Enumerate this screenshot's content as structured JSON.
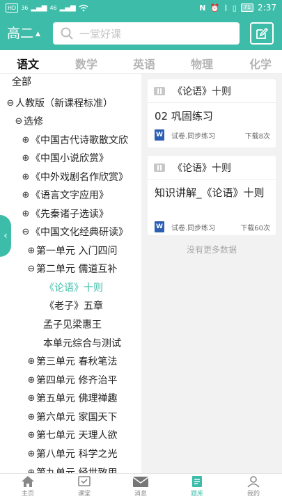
{
  "status_bar": {
    "left_indicators": [
      "HD",
      "36",
      "46"
    ],
    "battery": "71",
    "time": "2:37"
  },
  "header": {
    "grade": "高二",
    "search_placeholder": "一堂好课"
  },
  "tabs": [
    {
      "label": "语文",
      "active": true
    },
    {
      "label": "数学",
      "active": false
    },
    {
      "label": "英语",
      "active": false
    },
    {
      "label": "物理",
      "active": false
    },
    {
      "label": "化学",
      "active": false
    }
  ],
  "tree": [
    {
      "toggle": "",
      "label": "全部"
    },
    {
      "toggle": "⊖",
      "label": "人教版（新课程标准）"
    },
    {
      "toggle": "⊖",
      "label": "选修"
    },
    {
      "toggle": "⊕",
      "label": "《中国古代诗歌散文欣"
    },
    {
      "toggle": "⊕",
      "label": "《中国小说欣赏》"
    },
    {
      "toggle": "⊕",
      "label": "《中外戏剧名作欣赏》"
    },
    {
      "toggle": "⊕",
      "label": "《语言文字应用》"
    },
    {
      "toggle": "⊕",
      "label": "《先秦诸子选读》"
    },
    {
      "toggle": "⊖",
      "label": "《中国文化经典研读》"
    },
    {
      "toggle": "⊕",
      "label": "第一单元 入门四问"
    },
    {
      "toggle": "⊖",
      "label": "第二单元 儒道互补"
    },
    {
      "toggle": "",
      "label": "《论语》十则"
    },
    {
      "toggle": "",
      "label": "《老子》五章"
    },
    {
      "toggle": "",
      "label": "孟子见梁惠王"
    },
    {
      "toggle": "",
      "label": "本单元综合与测试"
    },
    {
      "toggle": "⊕",
      "label": "第三单元 春秋笔法"
    },
    {
      "toggle": "⊕",
      "label": "第四单元 修齐治平"
    },
    {
      "toggle": "⊕",
      "label": "第五单元 佛理禅趣"
    },
    {
      "toggle": "⊕",
      "label": "第六单元 家国天下"
    },
    {
      "toggle": "⊕",
      "label": "第七单元 天理人欲"
    },
    {
      "toggle": "⊕",
      "label": "第八单元 科学之光"
    },
    {
      "toggle": "⊕",
      "label": "第九单元 经世致用"
    }
  ],
  "cards": [
    {
      "category": "《论语》十则",
      "title": "02 巩固练习",
      "type_label": "试卷.同步练习",
      "downloads": "下载8次"
    },
    {
      "category": "《论语》十则",
      "title": "知识讲解_《论语》十则",
      "type_label": "试卷.同步练习",
      "downloads": "下载60次"
    }
  ],
  "no_more_text": "没有更多数据",
  "bottom_nav": [
    {
      "label": "主页",
      "icon": "home-icon",
      "active": false
    },
    {
      "label": "课堂",
      "icon": "classroom-icon",
      "active": false
    },
    {
      "label": "消息",
      "icon": "message-icon",
      "active": false
    },
    {
      "label": "题库",
      "icon": "question-bank-icon",
      "active": true
    },
    {
      "label": "我的",
      "icon": "profile-icon",
      "active": false
    }
  ],
  "colors": {
    "accent": "#3dbda9",
    "word_icon": "#2b5fb4"
  }
}
